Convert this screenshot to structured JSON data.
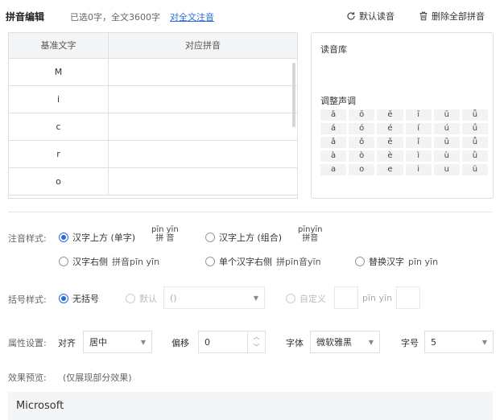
{
  "header": {
    "title": "拼音编辑",
    "info": "已选0字，全文3600字",
    "annotate_all_link": "对全文注音",
    "default_reading_btn": "默认读音",
    "delete_all_btn": "删除全部拼音"
  },
  "table": {
    "col1": "基准文字",
    "col2": "对应拼音",
    "rows": [
      {
        "char": "M",
        "pinyin": ""
      },
      {
        "char": "i",
        "pinyin": ""
      },
      {
        "char": "c",
        "pinyin": ""
      },
      {
        "char": "r",
        "pinyin": ""
      },
      {
        "char": "o",
        "pinyin": ""
      }
    ]
  },
  "library": {
    "title": "读音库",
    "tone_title": "调整声调",
    "tones": [
      [
        "ā",
        "ō",
        "ē",
        "ī",
        "ū",
        "ǖ"
      ],
      [
        "á",
        "ó",
        "é",
        "í",
        "ú",
        "ǘ"
      ],
      [
        "ǎ",
        "ǒ",
        "ě",
        "ǐ",
        "ǔ",
        "ǚ"
      ],
      [
        "à",
        "ò",
        "è",
        "ì",
        "ù",
        "ǜ"
      ],
      [
        "a",
        "o",
        "e",
        "i",
        "u",
        "ü"
      ]
    ]
  },
  "style": {
    "label": "注音样式:",
    "opt1": "汉字上方 (单字)",
    "opt1_py": "pīn yīn",
    "opt1_hz": "拼 音",
    "opt2": "汉字上方 (组合)",
    "opt2_py": "pīnyīn",
    "opt2_hz": "拼音",
    "opt3": "汉字右侧",
    "opt3_sample": "拼音pīn yīn",
    "opt4": "单个汉字右侧",
    "opt4_sample": "拼pīn音yīn",
    "opt5": "替换汉字",
    "opt5_sample": "pīn yīn"
  },
  "bracket": {
    "label": "括号样式:",
    "opt_none": "无括号",
    "opt_default": "默认",
    "default_value": "()",
    "opt_custom": "自定义",
    "custom_sample": "pīn yīn"
  },
  "props": {
    "label": "属性设置:",
    "align_label": "对齐",
    "align_value": "居中",
    "offset_label": "偏移",
    "offset_value": "0",
    "font_label": "字体",
    "font_value": "微软雅黑",
    "size_label": "字号",
    "size_value": "5"
  },
  "preview": {
    "label": "效果预览:",
    "note": "(仅展现部分效果)",
    "text": "Microsoft"
  }
}
